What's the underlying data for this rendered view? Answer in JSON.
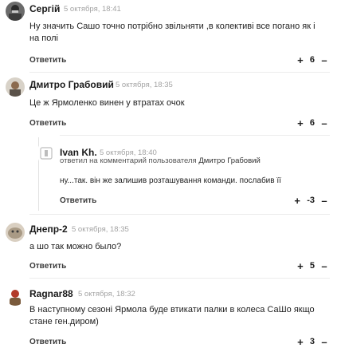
{
  "comments": [
    {
      "author": "Сергій",
      "date": "5 октября, 18:41",
      "text": "Ну значить Сашо точно потрібно звільняти ,в колективі все погано як і на полі",
      "reply_label": "Ответить",
      "score": "6"
    },
    {
      "author": "Дмитро Грабовий",
      "date": "5 октября, 18:35",
      "text": "Це ж Ярмоленко винен у втратах очок",
      "reply_label": "Ответить",
      "score": "6"
    },
    {
      "author": "Ivan Kh.",
      "date": "5 октября, 18:40",
      "reply_to_prefix": "ответил на комментарий пользователя",
      "reply_to_user": "Дмитро Грабовий",
      "text": "ну...так. він же залишив розташування команди. послабив її",
      "reply_label": "Ответить",
      "score": "-3"
    },
    {
      "author": "Днепр-2",
      "date": "5 октября, 18:35",
      "text": "а шо так можно было?",
      "reply_label": "Ответить",
      "score": "5"
    },
    {
      "author": "Ragnar88",
      "date": "5 октября, 18:32",
      "text": "В наступному сезоні Ярмола буде  втикати палки в колеса  СаШо якщо стане ген.диром)",
      "reply_label": "Ответить",
      "score": "3"
    }
  ],
  "icons": {
    "upvote": "plus-icon",
    "downvote": "minus-icon"
  },
  "colors": {
    "text": "#1e1e1e",
    "date": "#a3a3a3",
    "divider": "#ececec"
  }
}
